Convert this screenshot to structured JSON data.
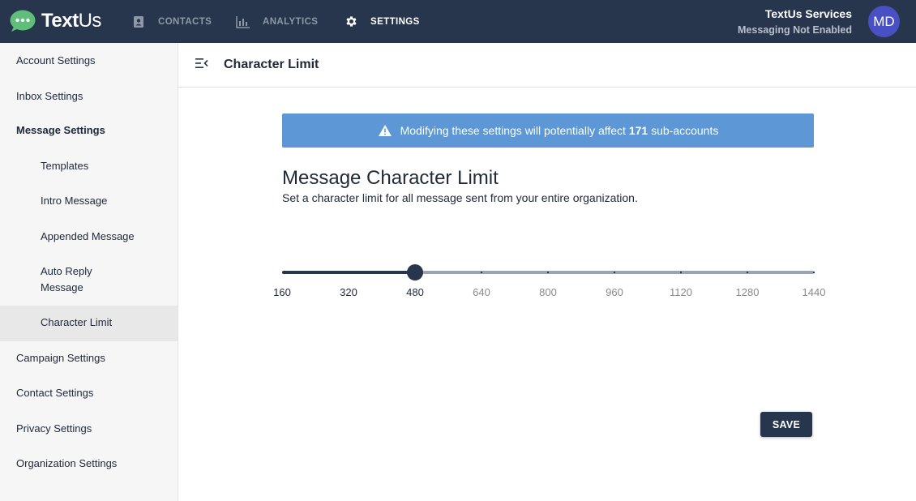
{
  "app": {
    "brand_text_prefix": "Text",
    "brand_text_suffix": "Us",
    "accent_color": "#27364d",
    "brand_bubble_color": "#5fbf7a"
  },
  "nav": {
    "items": [
      {
        "label": "CONTACTS",
        "icon": "contacts-icon",
        "active": false
      },
      {
        "label": "ANALYTICS",
        "icon": "analytics-icon",
        "active": false
      },
      {
        "label": "SETTINGS",
        "icon": "gear-icon",
        "active": true
      }
    ]
  },
  "account": {
    "org_name": "TextUs Services",
    "status": "Messaging Not Enabled",
    "avatar_initials": "MD",
    "avatar_color": "#4950c4"
  },
  "sidebar": {
    "items": [
      {
        "label": "Account Settings",
        "level": "top"
      },
      {
        "label": "Inbox Settings",
        "level": "top"
      },
      {
        "label": "Message Settings",
        "level": "top",
        "expanded": true
      },
      {
        "label": "Templates",
        "level": "sub"
      },
      {
        "label": "Intro Message",
        "level": "sub"
      },
      {
        "label": "Appended Message",
        "level": "sub"
      },
      {
        "label": "Auto Reply",
        "label_line2": "Message",
        "level": "sub"
      },
      {
        "label": "Character Limit",
        "level": "sub",
        "selected": true
      },
      {
        "label": "Campaign Settings",
        "level": "top"
      },
      {
        "label": "Contact Settings",
        "level": "top"
      },
      {
        "label": "Privacy Settings",
        "level": "top"
      },
      {
        "label": "Organization Settings",
        "level": "top"
      }
    ]
  },
  "header": {
    "title": "Character Limit"
  },
  "banner": {
    "text_before": "Modifying these settings will potentially affect ",
    "count": "171",
    "text_after": " sub-accounts",
    "color": "#5d97d6"
  },
  "section": {
    "title": "Message Character Limit",
    "description": "Set a character limit for all message sent from your entire organization."
  },
  "slider": {
    "marks": [
      "160",
      "320",
      "480",
      "640",
      "800",
      "960",
      "1120",
      "1280",
      "1440"
    ],
    "min": 160,
    "max": 1440,
    "step": 160,
    "value": 480
  },
  "actions": {
    "save_label": "SAVE"
  }
}
